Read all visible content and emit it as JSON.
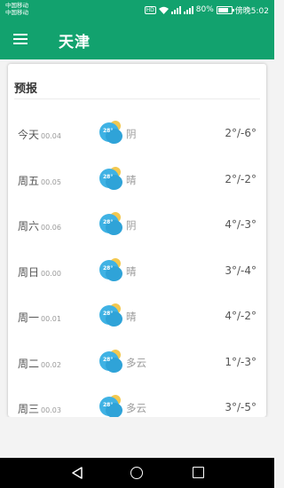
{
  "status_bar": {
    "carrier_line1": "中国移动",
    "carrier_line2": "中国移动",
    "hd": "HD",
    "signal_a": "4G",
    "signal_b": "2G",
    "battery_percent": "80%",
    "battery_level": 0.8,
    "time": "傍晚5:02"
  },
  "app_bar": {
    "title": "天津",
    "menu_icon": "hamburger-menu-icon"
  },
  "forecast": {
    "title": "预报",
    "rows": [
      {
        "day": "今天",
        "date": "00.04",
        "icon_temp": "28°",
        "condition": "阴",
        "temp": "2°/-6°"
      },
      {
        "day": "周五",
        "date": "00.05",
        "icon_temp": "28°",
        "condition": "晴",
        "temp": "2°/-2°"
      },
      {
        "day": "周六",
        "date": "00.06",
        "icon_temp": "28°",
        "condition": "阴",
        "temp": "4°/-3°"
      },
      {
        "day": "周日",
        "date": "00.00",
        "icon_temp": "28°",
        "condition": "晴",
        "temp": "3°/-4°"
      },
      {
        "day": "周一",
        "date": "00.01",
        "icon_temp": "28°",
        "condition": "晴",
        "temp": "4°/-2°"
      },
      {
        "day": "周二",
        "date": "00.02",
        "icon_temp": "28°",
        "condition": "多云",
        "temp": "1°/-3°"
      },
      {
        "day": "周三",
        "date": "00.03",
        "icon_temp": "28°",
        "condition": "多云",
        "temp": "3°/-5°"
      }
    ]
  },
  "colors": {
    "primary": "#12a26e",
    "icon_blue": "#3fb2e4",
    "icon_sun": "#f3c84f"
  }
}
